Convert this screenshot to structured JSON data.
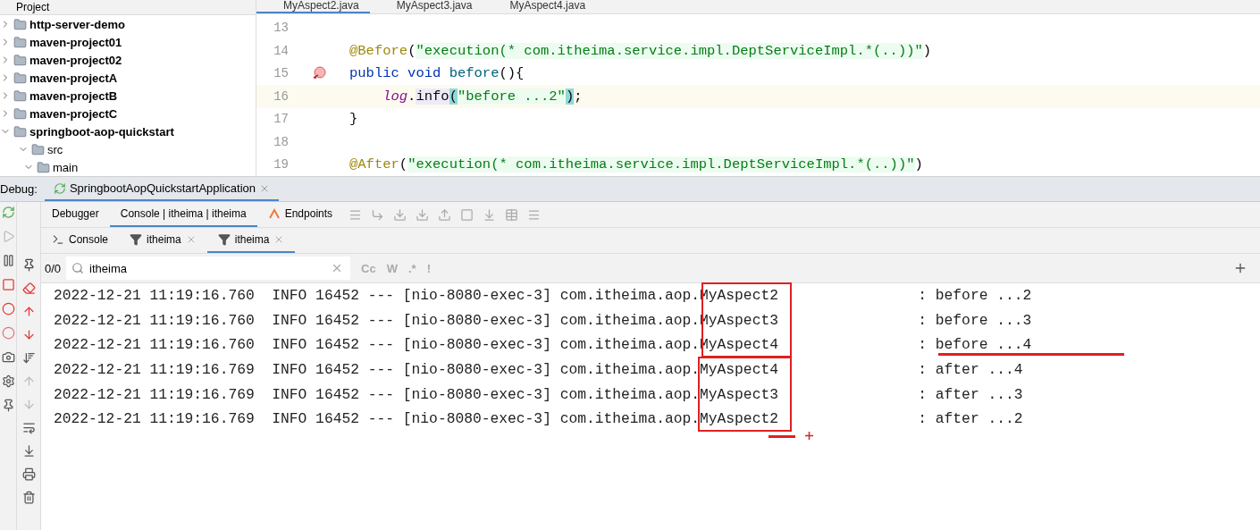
{
  "project_panel": {
    "title": "Project",
    "items": [
      {
        "label": "http-server-demo",
        "expanded": false
      },
      {
        "label": "maven-project01",
        "expanded": false
      },
      {
        "label": "maven-project02",
        "expanded": false
      },
      {
        "label": "maven-projectA",
        "expanded": false
      },
      {
        "label": "maven-projectB",
        "expanded": false
      },
      {
        "label": "maven-projectC",
        "expanded": false
      },
      {
        "label": "springboot-aop-quickstart",
        "expanded": true,
        "children": [
          {
            "label": "src",
            "expanded": true,
            "children": [
              {
                "label": "main",
                "expanded": true
              }
            ]
          }
        ]
      }
    ]
  },
  "editor_tabs": [
    {
      "label": "MyAspect2.java",
      "selected": true
    },
    {
      "label": "MyAspect3.java",
      "selected": false
    },
    {
      "label": "MyAspect4.java",
      "selected": false
    }
  ],
  "code_lines": [
    {
      "number": "13"
    },
    {
      "number": "14",
      "tokens": [
        {
          "kind": "annotation",
          "text": "@Before"
        },
        {
          "kind": "plain",
          "text": "("
        },
        {
          "kind": "string",
          "text": "\"execution(* com.itheima.service.impl.DeptServiceImpl.*(..))\""
        },
        {
          "kind": "plain",
          "text": ")"
        }
      ]
    },
    {
      "number": "15",
      "gutter_icon": true,
      "tokens": [
        {
          "kind": "keyword",
          "text": "public void "
        },
        {
          "kind": "method",
          "text": "before"
        },
        {
          "kind": "plain",
          "text": "(){"
        }
      ]
    },
    {
      "number": "16",
      "current": true,
      "indented": true,
      "tokens": [
        {
          "kind": "field",
          "text": "log"
        },
        {
          "kind": "plain",
          "text": "."
        },
        {
          "kind": "call",
          "text": "info"
        },
        {
          "kind": "brace",
          "text": "("
        },
        {
          "kind": "string",
          "text": "\"before ...2\""
        },
        {
          "kind": "brace",
          "text": ")"
        },
        {
          "kind": "plain",
          "text": ";"
        }
      ]
    },
    {
      "number": "17",
      "tokens": [
        {
          "kind": "plain",
          "text": "}"
        }
      ]
    },
    {
      "number": "18"
    },
    {
      "number": "19",
      "tokens": [
        {
          "kind": "annotation",
          "text": "@After"
        },
        {
          "kind": "plain",
          "text": "("
        },
        {
          "kind": "string",
          "text": "\"execution(* com.itheima.service.impl.DeptServiceImpl.*(..))\""
        },
        {
          "kind": "plain",
          "text": ")"
        }
      ]
    }
  ],
  "debug": {
    "label": "Debug:",
    "session": "SpringbootAopQuickstartApplication"
  },
  "debug_tabs": [
    {
      "label": "Debugger",
      "selected": false
    },
    {
      "label": "Console | itheima | itheima",
      "selected": true
    },
    {
      "label": "Endpoints",
      "selected": false
    }
  ],
  "console_tabs": [
    {
      "kind": "console",
      "label": "Console",
      "selected": false
    },
    {
      "kind": "filter",
      "label": "itheima",
      "selected": false
    },
    {
      "kind": "filter",
      "label": "itheima",
      "selected": true
    }
  ],
  "search": {
    "count": "0/0",
    "value": "itheima",
    "options": [
      "Cc",
      "W",
      ".*",
      "!"
    ]
  },
  "log_lines": [
    "2022-12-21 11:19:16.760  INFO 16452 --- [nio-8080-exec-3] com.itheima.aop.MyAspect2                : before ...2",
    "2022-12-21 11:19:16.760  INFO 16452 --- [nio-8080-exec-3] com.itheima.aop.MyAspect3                : before ...3",
    "2022-12-21 11:19:16.760  INFO 16452 --- [nio-8080-exec-3] com.itheima.aop.MyAspect4                : before ...4",
    "2022-12-21 11:19:16.769  INFO 16452 --- [nio-8080-exec-3] com.itheima.aop.MyAspect4                : after ...4",
    "2022-12-21 11:19:16.769  INFO 16452 --- [nio-8080-exec-3] com.itheima.aop.MyAspect3                : after ...3",
    "2022-12-21 11:19:16.769  INFO 16452 --- [nio-8080-exec-3] com.itheima.aop.MyAspect2                : after ...2"
  ]
}
